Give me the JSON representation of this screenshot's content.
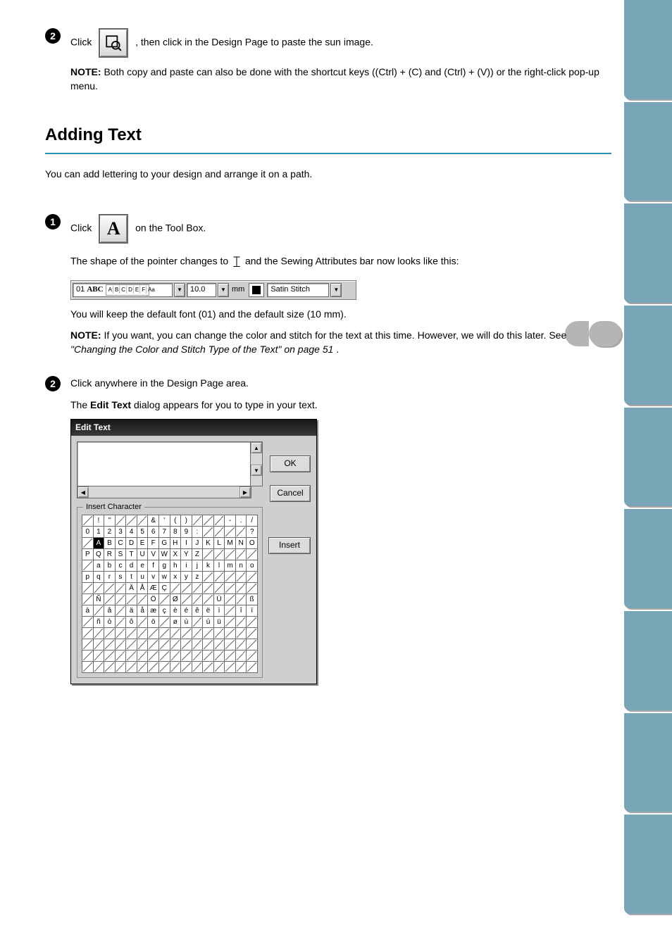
{
  "step2": {
    "text_before_icon": "Click",
    "text_after_icon": ", then click in the Design Page to paste the sun image.",
    "note_label": "NOTE:",
    "note_text": "Both copy and paste can also be done with the shortcut keys ((Ctrl) + (C) and (Ctrl) + (V)) or the right-click pop-up menu."
  },
  "heading": "Adding Text",
  "intro": "You can add lettering to your design and arrange it on a path.",
  "step1b": {
    "click": "Click",
    "text_after_icon": "on the Tool Box.",
    "cursor_line_prefix": "The shape of the pointer changes to",
    "cursor_line_suffix": "and the Sewing Attributes bar now looks like this:"
  },
  "sewbar": {
    "font_id": "01",
    "font_name": "ABC",
    "thumb": [
      "A",
      "B",
      "C",
      "D",
      "E",
      "F",
      "Aa"
    ],
    "size": "10.0",
    "unit": "mm",
    "stitch": "Satin Stitch"
  },
  "after_sewbar": {
    "p1": "You will keep the default font (01) and the default size (10 mm).",
    "note_label": "NOTE:",
    "note_text_prefix": "If you want, you can change the color and stitch for the text at this time. However, we will do this later. See ",
    "note_link": "\"Changing the Color and Stitch Type of the Text\" on page 51",
    "note_text_suffix": "."
  },
  "step2b": {
    "line1": "Click anywhere in the Design Page area.",
    "line2_prefix": "The ",
    "line2_bold": "Edit Text",
    "line2_suffix": " dialog appears for you to type in your text."
  },
  "dialog": {
    "title": "Edit Text",
    "group_label": "Insert Character",
    "buttons": {
      "ok": "OK",
      "cancel": "Cancel",
      "insert": "Insert"
    }
  },
  "char_rows": [
    [
      {
        "c": "",
        "na": true
      },
      {
        "c": "!"
      },
      {
        "c": "\""
      },
      {
        "c": "",
        "na": true
      },
      {
        "c": "",
        "na": true
      },
      {
        "c": "",
        "na": true
      },
      {
        "c": "&"
      },
      {
        "c": "'"
      },
      {
        "c": "("
      },
      {
        "c": ")"
      },
      {
        "c": "",
        "na": true
      },
      {
        "c": "",
        "na": true
      },
      {
        "c": "",
        "na": true
      },
      {
        "c": "-"
      },
      {
        "c": "."
      },
      {
        "c": "/"
      }
    ],
    [
      {
        "c": "0"
      },
      {
        "c": "1"
      },
      {
        "c": "2"
      },
      {
        "c": "3"
      },
      {
        "c": "4"
      },
      {
        "c": "5"
      },
      {
        "c": "6"
      },
      {
        "c": "7"
      },
      {
        "c": "8"
      },
      {
        "c": "9"
      },
      {
        "c": ":"
      },
      {
        "c": "",
        "na": true
      },
      {
        "c": "",
        "na": true
      },
      {
        "c": "",
        "na": true
      },
      {
        "c": "",
        "na": true
      },
      {
        "c": "?"
      }
    ],
    [
      {
        "c": "",
        "na": true
      },
      {
        "c": "A",
        "sel": true
      },
      {
        "c": "B"
      },
      {
        "c": "C"
      },
      {
        "c": "D"
      },
      {
        "c": "E"
      },
      {
        "c": "F"
      },
      {
        "c": "G"
      },
      {
        "c": "H"
      },
      {
        "c": "I"
      },
      {
        "c": "J"
      },
      {
        "c": "K"
      },
      {
        "c": "L"
      },
      {
        "c": "M"
      },
      {
        "c": "N"
      },
      {
        "c": "O"
      }
    ],
    [
      {
        "c": "P"
      },
      {
        "c": "Q"
      },
      {
        "c": "R"
      },
      {
        "c": "S"
      },
      {
        "c": "T"
      },
      {
        "c": "U"
      },
      {
        "c": "V"
      },
      {
        "c": "W"
      },
      {
        "c": "X"
      },
      {
        "c": "Y"
      },
      {
        "c": "Z"
      },
      {
        "c": "",
        "na": true
      },
      {
        "c": "",
        "na": true
      },
      {
        "c": "",
        "na": true
      },
      {
        "c": "",
        "na": true
      },
      {
        "c": "",
        "na": true
      }
    ],
    [
      {
        "c": "",
        "na": true
      },
      {
        "c": "a"
      },
      {
        "c": "b"
      },
      {
        "c": "c"
      },
      {
        "c": "d"
      },
      {
        "c": "e"
      },
      {
        "c": "f"
      },
      {
        "c": "g"
      },
      {
        "c": "h"
      },
      {
        "c": "i"
      },
      {
        "c": "j"
      },
      {
        "c": "k"
      },
      {
        "c": "l"
      },
      {
        "c": "m"
      },
      {
        "c": "n"
      },
      {
        "c": "o"
      }
    ],
    [
      {
        "c": "p"
      },
      {
        "c": "q"
      },
      {
        "c": "r"
      },
      {
        "c": "s"
      },
      {
        "c": "t"
      },
      {
        "c": "u"
      },
      {
        "c": "v"
      },
      {
        "c": "w"
      },
      {
        "c": "x"
      },
      {
        "c": "y"
      },
      {
        "c": "z"
      },
      {
        "c": "",
        "na": true
      },
      {
        "c": "",
        "na": true
      },
      {
        "c": "",
        "na": true
      },
      {
        "c": "",
        "na": true
      },
      {
        "c": "",
        "na": true
      }
    ],
    [
      {
        "c": "",
        "na": true
      },
      {
        "c": "",
        "na": true
      },
      {
        "c": "",
        "na": true
      },
      {
        "c": "",
        "na": true
      },
      {
        "c": "Ä"
      },
      {
        "c": "Å"
      },
      {
        "c": "Æ"
      },
      {
        "c": "Ç"
      },
      {
        "c": "",
        "na": true
      },
      {
        "c": "",
        "na": true
      },
      {
        "c": "",
        "na": true
      },
      {
        "c": "",
        "na": true
      },
      {
        "c": "",
        "na": true
      },
      {
        "c": "",
        "na": true
      },
      {
        "c": "",
        "na": true
      },
      {
        "c": "",
        "na": true
      }
    ],
    [
      {
        "c": "",
        "na": true
      },
      {
        "c": "Ñ"
      },
      {
        "c": "",
        "na": true
      },
      {
        "c": "",
        "na": true
      },
      {
        "c": "",
        "na": true
      },
      {
        "c": "",
        "na": true
      },
      {
        "c": "Ö"
      },
      {
        "c": "",
        "na": true
      },
      {
        "c": "Ø"
      },
      {
        "c": "",
        "na": true
      },
      {
        "c": "",
        "na": true
      },
      {
        "c": "",
        "na": true
      },
      {
        "c": "Ü"
      },
      {
        "c": "",
        "na": true
      },
      {
        "c": "",
        "na": true
      },
      {
        "c": "ß"
      }
    ],
    [
      {
        "c": "à"
      },
      {
        "c": "",
        "na": true
      },
      {
        "c": "â"
      },
      {
        "c": "",
        "na": true
      },
      {
        "c": "ä"
      },
      {
        "c": "å"
      },
      {
        "c": "æ"
      },
      {
        "c": "ç"
      },
      {
        "c": "è"
      },
      {
        "c": "é"
      },
      {
        "c": "ê"
      },
      {
        "c": "ë"
      },
      {
        "c": "ì"
      },
      {
        "c": "",
        "na": true
      },
      {
        "c": "î"
      },
      {
        "c": "ï"
      }
    ],
    [
      {
        "c": "",
        "na": true
      },
      {
        "c": "ñ"
      },
      {
        "c": "ò"
      },
      {
        "c": "",
        "na": true
      },
      {
        "c": "ô"
      },
      {
        "c": "",
        "na": true
      },
      {
        "c": "ö"
      },
      {
        "c": "",
        "na": true
      },
      {
        "c": "ø"
      },
      {
        "c": "ù"
      },
      {
        "c": "",
        "na": true
      },
      {
        "c": "ú"
      },
      {
        "c": "ü"
      },
      {
        "c": "",
        "na": true
      },
      {
        "c": "",
        "na": true
      },
      {
        "c": "",
        "na": true
      }
    ],
    [
      {
        "c": "",
        "na": true
      },
      {
        "c": "",
        "na": true
      },
      {
        "c": "",
        "na": true
      },
      {
        "c": "",
        "na": true
      },
      {
        "c": "",
        "na": true
      },
      {
        "c": "",
        "na": true
      },
      {
        "c": "",
        "na": true
      },
      {
        "c": "",
        "na": true
      },
      {
        "c": "",
        "na": true
      },
      {
        "c": "",
        "na": true
      },
      {
        "c": "",
        "na": true
      },
      {
        "c": "",
        "na": true
      },
      {
        "c": "",
        "na": true
      },
      {
        "c": "",
        "na": true
      },
      {
        "c": "",
        "na": true
      },
      {
        "c": "",
        "na": true
      }
    ],
    [
      {
        "c": "",
        "na": true
      },
      {
        "c": "",
        "na": true
      },
      {
        "c": "",
        "na": true
      },
      {
        "c": "",
        "na": true
      },
      {
        "c": "",
        "na": true
      },
      {
        "c": "",
        "na": true
      },
      {
        "c": "",
        "na": true
      },
      {
        "c": "",
        "na": true
      },
      {
        "c": "",
        "na": true
      },
      {
        "c": "",
        "na": true
      },
      {
        "c": "",
        "na": true
      },
      {
        "c": "",
        "na": true
      },
      {
        "c": "",
        "na": true
      },
      {
        "c": "",
        "na": true
      },
      {
        "c": "",
        "na": true
      },
      {
        "c": "",
        "na": true
      }
    ],
    [
      {
        "c": "",
        "na": true
      },
      {
        "c": "",
        "na": true
      },
      {
        "c": "",
        "na": true
      },
      {
        "c": "",
        "na": true
      },
      {
        "c": "",
        "na": true
      },
      {
        "c": "",
        "na": true
      },
      {
        "c": "",
        "na": true
      },
      {
        "c": "",
        "na": true
      },
      {
        "c": "",
        "na": true
      },
      {
        "c": "",
        "na": true
      },
      {
        "c": "",
        "na": true
      },
      {
        "c": "",
        "na": true
      },
      {
        "c": "",
        "na": true
      },
      {
        "c": "",
        "na": true
      },
      {
        "c": "",
        "na": true
      },
      {
        "c": "",
        "na": true
      }
    ],
    [
      {
        "c": "",
        "na": true
      },
      {
        "c": "",
        "na": true
      },
      {
        "c": "",
        "na": true
      },
      {
        "c": "",
        "na": true
      },
      {
        "c": "",
        "na": true
      },
      {
        "c": "",
        "na": true
      },
      {
        "c": "",
        "na": true
      },
      {
        "c": "",
        "na": true
      },
      {
        "c": "",
        "na": true
      },
      {
        "c": "",
        "na": true
      },
      {
        "c": "",
        "na": true
      },
      {
        "c": "",
        "na": true
      },
      {
        "c": "",
        "na": true
      },
      {
        "c": "",
        "na": true
      },
      {
        "c": "",
        "na": true
      },
      {
        "c": "",
        "na": true
      }
    ]
  ]
}
